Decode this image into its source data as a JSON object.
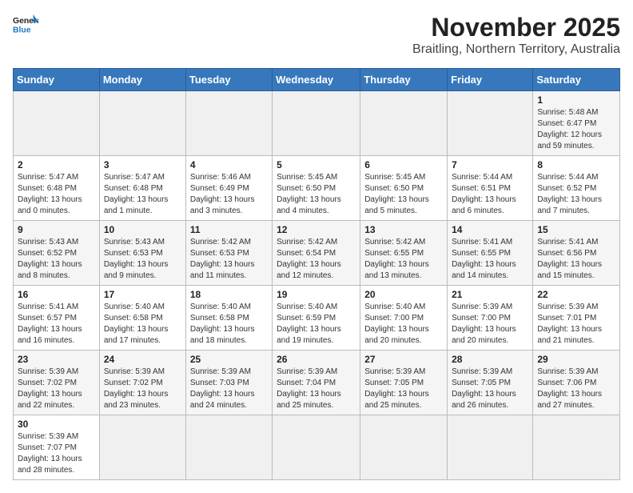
{
  "logo": {
    "text_general": "General",
    "text_blue": "Blue"
  },
  "header": {
    "month_year": "November 2025",
    "location": "Braitling, Northern Territory, Australia"
  },
  "days_of_week": [
    "Sunday",
    "Monday",
    "Tuesday",
    "Wednesday",
    "Thursday",
    "Friday",
    "Saturday"
  ],
  "weeks": [
    [
      {
        "day": "",
        "content": ""
      },
      {
        "day": "",
        "content": ""
      },
      {
        "day": "",
        "content": ""
      },
      {
        "day": "",
        "content": ""
      },
      {
        "day": "",
        "content": ""
      },
      {
        "day": "",
        "content": ""
      },
      {
        "day": "1",
        "content": "Sunrise: 5:48 AM\nSunset: 6:47 PM\nDaylight: 12 hours and 59 minutes."
      }
    ],
    [
      {
        "day": "2",
        "content": "Sunrise: 5:47 AM\nSunset: 6:48 PM\nDaylight: 13 hours and 0 minutes."
      },
      {
        "day": "3",
        "content": "Sunrise: 5:47 AM\nSunset: 6:48 PM\nDaylight: 13 hours and 1 minute."
      },
      {
        "day": "4",
        "content": "Sunrise: 5:46 AM\nSunset: 6:49 PM\nDaylight: 13 hours and 3 minutes."
      },
      {
        "day": "5",
        "content": "Sunrise: 5:45 AM\nSunset: 6:50 PM\nDaylight: 13 hours and 4 minutes."
      },
      {
        "day": "6",
        "content": "Sunrise: 5:45 AM\nSunset: 6:50 PM\nDaylight: 13 hours and 5 minutes."
      },
      {
        "day": "7",
        "content": "Sunrise: 5:44 AM\nSunset: 6:51 PM\nDaylight: 13 hours and 6 minutes."
      },
      {
        "day": "8",
        "content": "Sunrise: 5:44 AM\nSunset: 6:52 PM\nDaylight: 13 hours and 7 minutes."
      }
    ],
    [
      {
        "day": "9",
        "content": "Sunrise: 5:43 AM\nSunset: 6:52 PM\nDaylight: 13 hours and 8 minutes."
      },
      {
        "day": "10",
        "content": "Sunrise: 5:43 AM\nSunset: 6:53 PM\nDaylight: 13 hours and 9 minutes."
      },
      {
        "day": "11",
        "content": "Sunrise: 5:42 AM\nSunset: 6:53 PM\nDaylight: 13 hours and 11 minutes."
      },
      {
        "day": "12",
        "content": "Sunrise: 5:42 AM\nSunset: 6:54 PM\nDaylight: 13 hours and 12 minutes."
      },
      {
        "day": "13",
        "content": "Sunrise: 5:42 AM\nSunset: 6:55 PM\nDaylight: 13 hours and 13 minutes."
      },
      {
        "day": "14",
        "content": "Sunrise: 5:41 AM\nSunset: 6:55 PM\nDaylight: 13 hours and 14 minutes."
      },
      {
        "day": "15",
        "content": "Sunrise: 5:41 AM\nSunset: 6:56 PM\nDaylight: 13 hours and 15 minutes."
      }
    ],
    [
      {
        "day": "16",
        "content": "Sunrise: 5:41 AM\nSunset: 6:57 PM\nDaylight: 13 hours and 16 minutes."
      },
      {
        "day": "17",
        "content": "Sunrise: 5:40 AM\nSunset: 6:58 PM\nDaylight: 13 hours and 17 minutes."
      },
      {
        "day": "18",
        "content": "Sunrise: 5:40 AM\nSunset: 6:58 PM\nDaylight: 13 hours and 18 minutes."
      },
      {
        "day": "19",
        "content": "Sunrise: 5:40 AM\nSunset: 6:59 PM\nDaylight: 13 hours and 19 minutes."
      },
      {
        "day": "20",
        "content": "Sunrise: 5:40 AM\nSunset: 7:00 PM\nDaylight: 13 hours and 20 minutes."
      },
      {
        "day": "21",
        "content": "Sunrise: 5:39 AM\nSunset: 7:00 PM\nDaylight: 13 hours and 20 minutes."
      },
      {
        "day": "22",
        "content": "Sunrise: 5:39 AM\nSunset: 7:01 PM\nDaylight: 13 hours and 21 minutes."
      }
    ],
    [
      {
        "day": "23",
        "content": "Sunrise: 5:39 AM\nSunset: 7:02 PM\nDaylight: 13 hours and 22 minutes."
      },
      {
        "day": "24",
        "content": "Sunrise: 5:39 AM\nSunset: 7:02 PM\nDaylight: 13 hours and 23 minutes."
      },
      {
        "day": "25",
        "content": "Sunrise: 5:39 AM\nSunset: 7:03 PM\nDaylight: 13 hours and 24 minutes."
      },
      {
        "day": "26",
        "content": "Sunrise: 5:39 AM\nSunset: 7:04 PM\nDaylight: 13 hours and 25 minutes."
      },
      {
        "day": "27",
        "content": "Sunrise: 5:39 AM\nSunset: 7:05 PM\nDaylight: 13 hours and 25 minutes."
      },
      {
        "day": "28",
        "content": "Sunrise: 5:39 AM\nSunset: 7:05 PM\nDaylight: 13 hours and 26 minutes."
      },
      {
        "day": "29",
        "content": "Sunrise: 5:39 AM\nSunset: 7:06 PM\nDaylight: 13 hours and 27 minutes."
      }
    ],
    [
      {
        "day": "30",
        "content": "Sunrise: 5:39 AM\nSunset: 7:07 PM\nDaylight: 13 hours and 28 minutes."
      },
      {
        "day": "",
        "content": ""
      },
      {
        "day": "",
        "content": ""
      },
      {
        "day": "",
        "content": ""
      },
      {
        "day": "",
        "content": ""
      },
      {
        "day": "",
        "content": ""
      },
      {
        "day": "",
        "content": ""
      }
    ]
  ]
}
